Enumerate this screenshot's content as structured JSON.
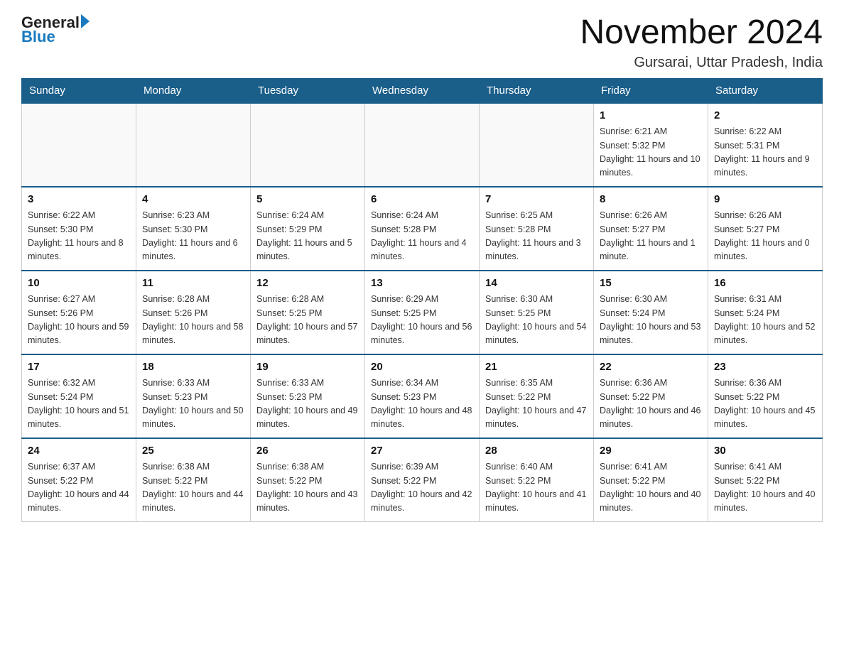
{
  "header": {
    "logo_general": "General",
    "logo_blue": "Blue",
    "month_year": "November 2024",
    "location": "Gursarai, Uttar Pradesh, India"
  },
  "days_of_week": [
    "Sunday",
    "Monday",
    "Tuesday",
    "Wednesday",
    "Thursday",
    "Friday",
    "Saturday"
  ],
  "weeks": [
    [
      {
        "day": "",
        "info": ""
      },
      {
        "day": "",
        "info": ""
      },
      {
        "day": "",
        "info": ""
      },
      {
        "day": "",
        "info": ""
      },
      {
        "day": "",
        "info": ""
      },
      {
        "day": "1",
        "info": "Sunrise: 6:21 AM\nSunset: 5:32 PM\nDaylight: 11 hours and 10 minutes."
      },
      {
        "day": "2",
        "info": "Sunrise: 6:22 AM\nSunset: 5:31 PM\nDaylight: 11 hours and 9 minutes."
      }
    ],
    [
      {
        "day": "3",
        "info": "Sunrise: 6:22 AM\nSunset: 5:30 PM\nDaylight: 11 hours and 8 minutes."
      },
      {
        "day": "4",
        "info": "Sunrise: 6:23 AM\nSunset: 5:30 PM\nDaylight: 11 hours and 6 minutes."
      },
      {
        "day": "5",
        "info": "Sunrise: 6:24 AM\nSunset: 5:29 PM\nDaylight: 11 hours and 5 minutes."
      },
      {
        "day": "6",
        "info": "Sunrise: 6:24 AM\nSunset: 5:28 PM\nDaylight: 11 hours and 4 minutes."
      },
      {
        "day": "7",
        "info": "Sunrise: 6:25 AM\nSunset: 5:28 PM\nDaylight: 11 hours and 3 minutes."
      },
      {
        "day": "8",
        "info": "Sunrise: 6:26 AM\nSunset: 5:27 PM\nDaylight: 11 hours and 1 minute."
      },
      {
        "day": "9",
        "info": "Sunrise: 6:26 AM\nSunset: 5:27 PM\nDaylight: 11 hours and 0 minutes."
      }
    ],
    [
      {
        "day": "10",
        "info": "Sunrise: 6:27 AM\nSunset: 5:26 PM\nDaylight: 10 hours and 59 minutes."
      },
      {
        "day": "11",
        "info": "Sunrise: 6:28 AM\nSunset: 5:26 PM\nDaylight: 10 hours and 58 minutes."
      },
      {
        "day": "12",
        "info": "Sunrise: 6:28 AM\nSunset: 5:25 PM\nDaylight: 10 hours and 57 minutes."
      },
      {
        "day": "13",
        "info": "Sunrise: 6:29 AM\nSunset: 5:25 PM\nDaylight: 10 hours and 56 minutes."
      },
      {
        "day": "14",
        "info": "Sunrise: 6:30 AM\nSunset: 5:25 PM\nDaylight: 10 hours and 54 minutes."
      },
      {
        "day": "15",
        "info": "Sunrise: 6:30 AM\nSunset: 5:24 PM\nDaylight: 10 hours and 53 minutes."
      },
      {
        "day": "16",
        "info": "Sunrise: 6:31 AM\nSunset: 5:24 PM\nDaylight: 10 hours and 52 minutes."
      }
    ],
    [
      {
        "day": "17",
        "info": "Sunrise: 6:32 AM\nSunset: 5:24 PM\nDaylight: 10 hours and 51 minutes."
      },
      {
        "day": "18",
        "info": "Sunrise: 6:33 AM\nSunset: 5:23 PM\nDaylight: 10 hours and 50 minutes."
      },
      {
        "day": "19",
        "info": "Sunrise: 6:33 AM\nSunset: 5:23 PM\nDaylight: 10 hours and 49 minutes."
      },
      {
        "day": "20",
        "info": "Sunrise: 6:34 AM\nSunset: 5:23 PM\nDaylight: 10 hours and 48 minutes."
      },
      {
        "day": "21",
        "info": "Sunrise: 6:35 AM\nSunset: 5:22 PM\nDaylight: 10 hours and 47 minutes."
      },
      {
        "day": "22",
        "info": "Sunrise: 6:36 AM\nSunset: 5:22 PM\nDaylight: 10 hours and 46 minutes."
      },
      {
        "day": "23",
        "info": "Sunrise: 6:36 AM\nSunset: 5:22 PM\nDaylight: 10 hours and 45 minutes."
      }
    ],
    [
      {
        "day": "24",
        "info": "Sunrise: 6:37 AM\nSunset: 5:22 PM\nDaylight: 10 hours and 44 minutes."
      },
      {
        "day": "25",
        "info": "Sunrise: 6:38 AM\nSunset: 5:22 PM\nDaylight: 10 hours and 44 minutes."
      },
      {
        "day": "26",
        "info": "Sunrise: 6:38 AM\nSunset: 5:22 PM\nDaylight: 10 hours and 43 minutes."
      },
      {
        "day": "27",
        "info": "Sunrise: 6:39 AM\nSunset: 5:22 PM\nDaylight: 10 hours and 42 minutes."
      },
      {
        "day": "28",
        "info": "Sunrise: 6:40 AM\nSunset: 5:22 PM\nDaylight: 10 hours and 41 minutes."
      },
      {
        "day": "29",
        "info": "Sunrise: 6:41 AM\nSunset: 5:22 PM\nDaylight: 10 hours and 40 minutes."
      },
      {
        "day": "30",
        "info": "Sunrise: 6:41 AM\nSunset: 5:22 PM\nDaylight: 10 hours and 40 minutes."
      }
    ]
  ]
}
